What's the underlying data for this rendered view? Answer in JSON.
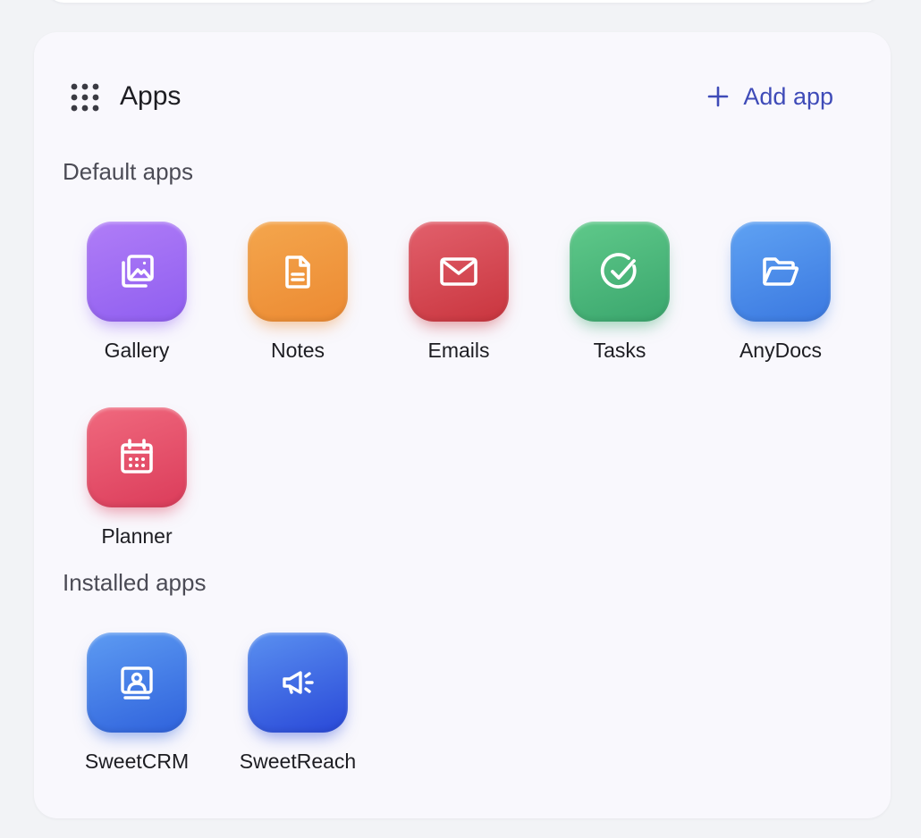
{
  "header": {
    "title": "Apps",
    "icon": "grid-icon",
    "add_app_label": "Add app",
    "add_icon": "plus-icon",
    "accent": "#3f4bb8"
  },
  "sections": {
    "default_title": "Default apps",
    "installed_title": "Installed apps"
  },
  "default_apps": [
    {
      "label": "Gallery",
      "icon": "gallery-icon",
      "color_top": "#b07df7",
      "color_bottom": "#8f5ef0"
    },
    {
      "label": "Notes",
      "icon": "note-icon",
      "color_top": "#f4a64d",
      "color_bottom": "#ec8a32"
    },
    {
      "label": "Emails",
      "icon": "mail-icon",
      "color_top": "#e2606c",
      "color_bottom": "#c9353e"
    },
    {
      "label": "Tasks",
      "icon": "check-circle-icon",
      "color_top": "#5fc98a",
      "color_bottom": "#3aa66d"
    },
    {
      "label": "AnyDocs",
      "icon": "folder-icon",
      "color_top": "#5fa2f3",
      "color_bottom": "#3a78e0"
    },
    {
      "label": "Planner",
      "icon": "calendar-icon",
      "color_top": "#f0697e",
      "color_bottom": "#db3c5a"
    }
  ],
  "installed_apps": [
    {
      "label": "SweetCRM",
      "icon": "contact-card-icon",
      "color_top": "#5d9bf2",
      "color_bottom": "#2f62dc"
    },
    {
      "label": "SweetReach",
      "icon": "megaphone-icon",
      "color_top": "#5a90f0",
      "color_bottom": "#2948d8"
    }
  ]
}
